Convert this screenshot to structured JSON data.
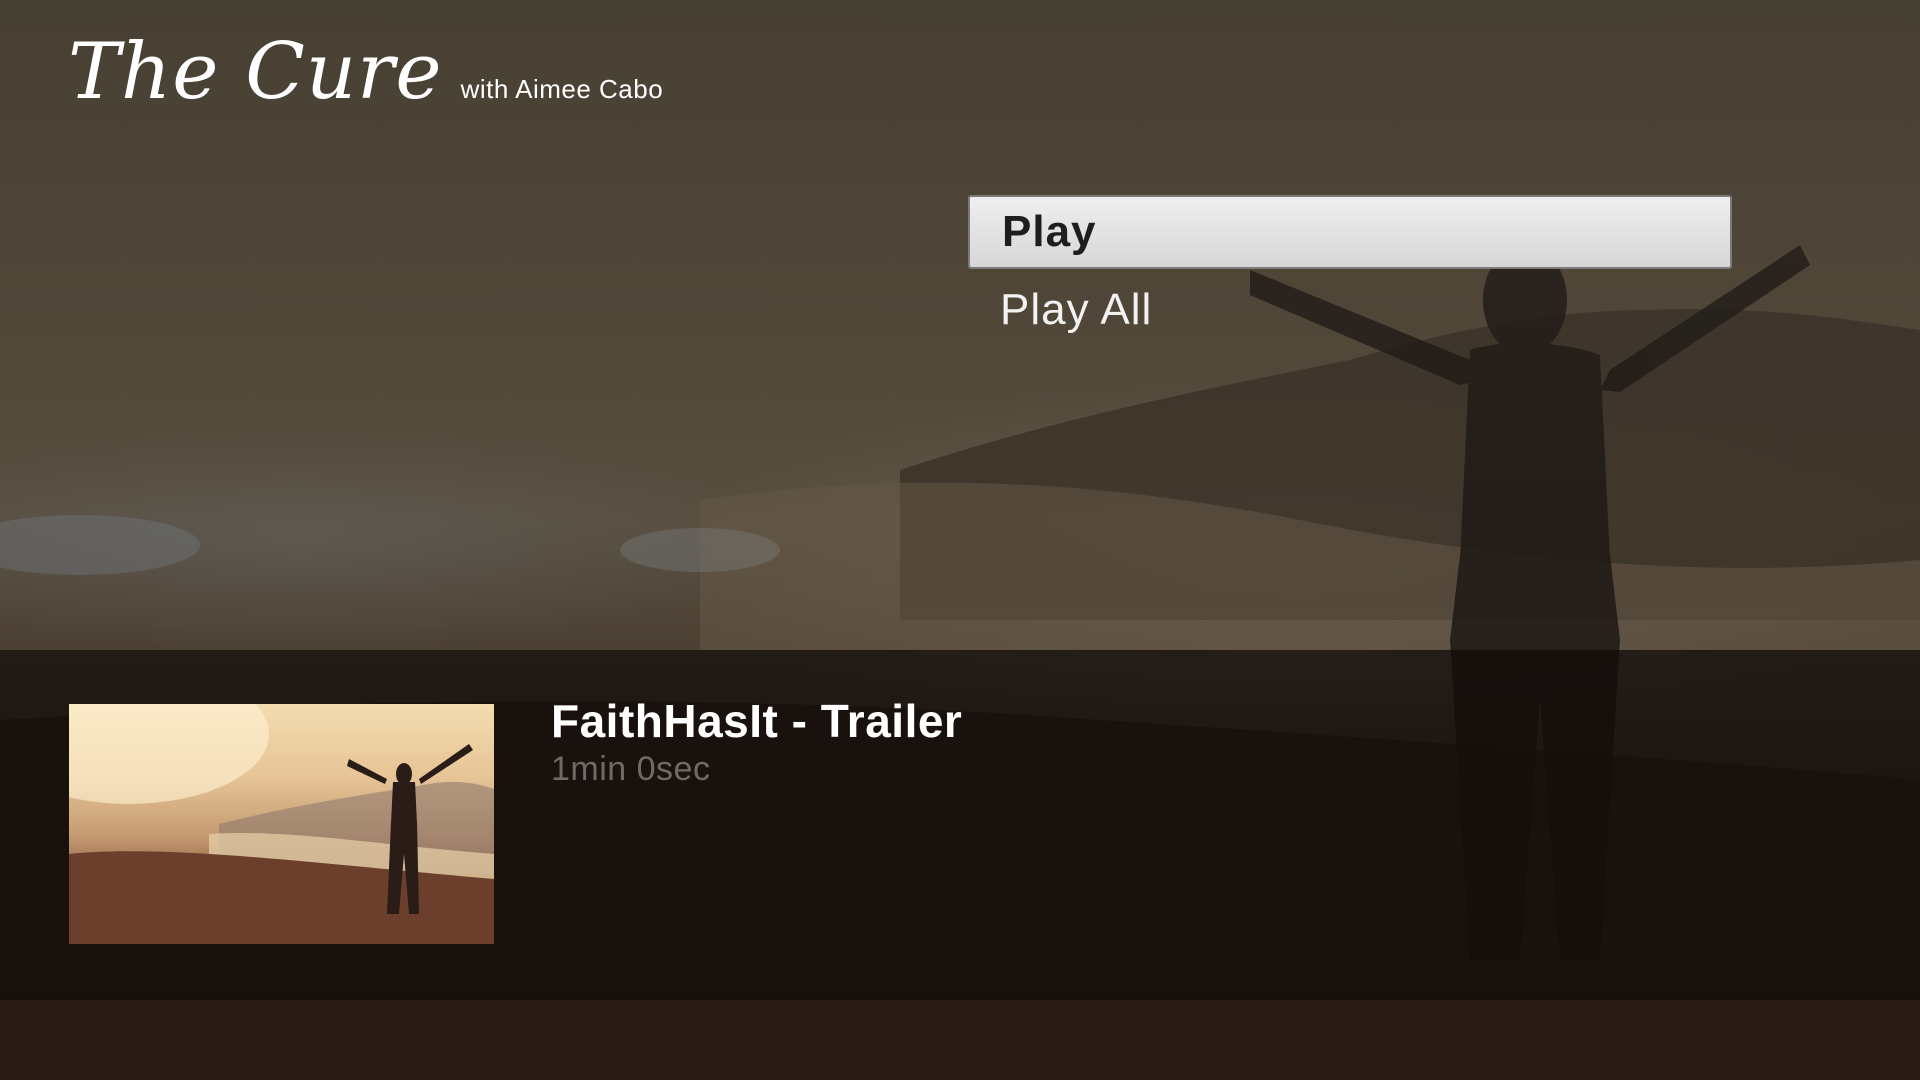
{
  "app": {
    "logo_title": "The Cure",
    "logo_subtitle": "with Aimee Cabo"
  },
  "menu": {
    "items": [
      {
        "label": "Play",
        "selected": true
      },
      {
        "label": "Play All",
        "selected": false
      }
    ]
  },
  "episode": {
    "title": "FaithHasIt - Trailer",
    "duration": "1min 0sec",
    "thumbnail_icon": "video-thumbnail-image"
  },
  "colors": {
    "highlight": "#e3e3e3",
    "band": "#120c0a",
    "text_primary": "#ffffff",
    "text_secondary": "#6f6a66"
  }
}
